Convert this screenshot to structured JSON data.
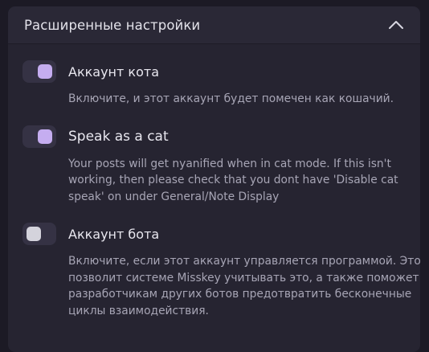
{
  "section": {
    "title": "Расширенные настройки",
    "collapse_icon": "chevron-up-icon"
  },
  "settings": [
    {
      "label": "Аккаунт кота",
      "enabled": true,
      "caption": "Включите, и этот аккаунт будет помечен как кошачий."
    },
    {
      "label": "Speak as a cat",
      "enabled": true,
      "caption": "Your posts will get nyanified when in cat mode. If this isn't working, then please check that you dont have 'Disable cat speak' on under General/Note Display"
    },
    {
      "label": "Аккаунт бота",
      "enabled": false,
      "caption": "Включите, если этот аккаунт управляется программой. Это позволит системе Misskey учитывать это, а также поможет разработчикам других ботов предотвратить бесконечные циклы взаимодействия."
    }
  ],
  "colors": {
    "toggle_on_knob": "#c5adf0",
    "toggle_off_knob": "#d4d3dc",
    "panel_bg": "#262431",
    "page_bg": "#1c1a25"
  }
}
